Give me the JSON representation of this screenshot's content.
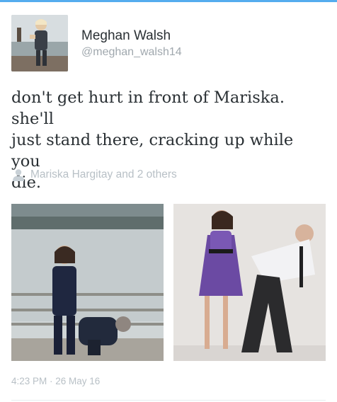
{
  "tweet": {
    "display_name": "Meghan Walsh",
    "handle": "@meghan_walsh14",
    "text_lines": [
      "don't get hurt in front of Mariska. she'll",
      "just stand there, cracking up while you",
      "die."
    ],
    "tagged_people": "Mariska Hargitay and 2 others",
    "timestamp": "4:23 PM · 26 May 16"
  },
  "icons": {
    "tagged": "person-icon"
  },
  "colors": {
    "accent": "#55acee",
    "name_text": "#292f33",
    "meta_text": "#a0a8ae",
    "light_meta_text": "#b8c0c6"
  }
}
